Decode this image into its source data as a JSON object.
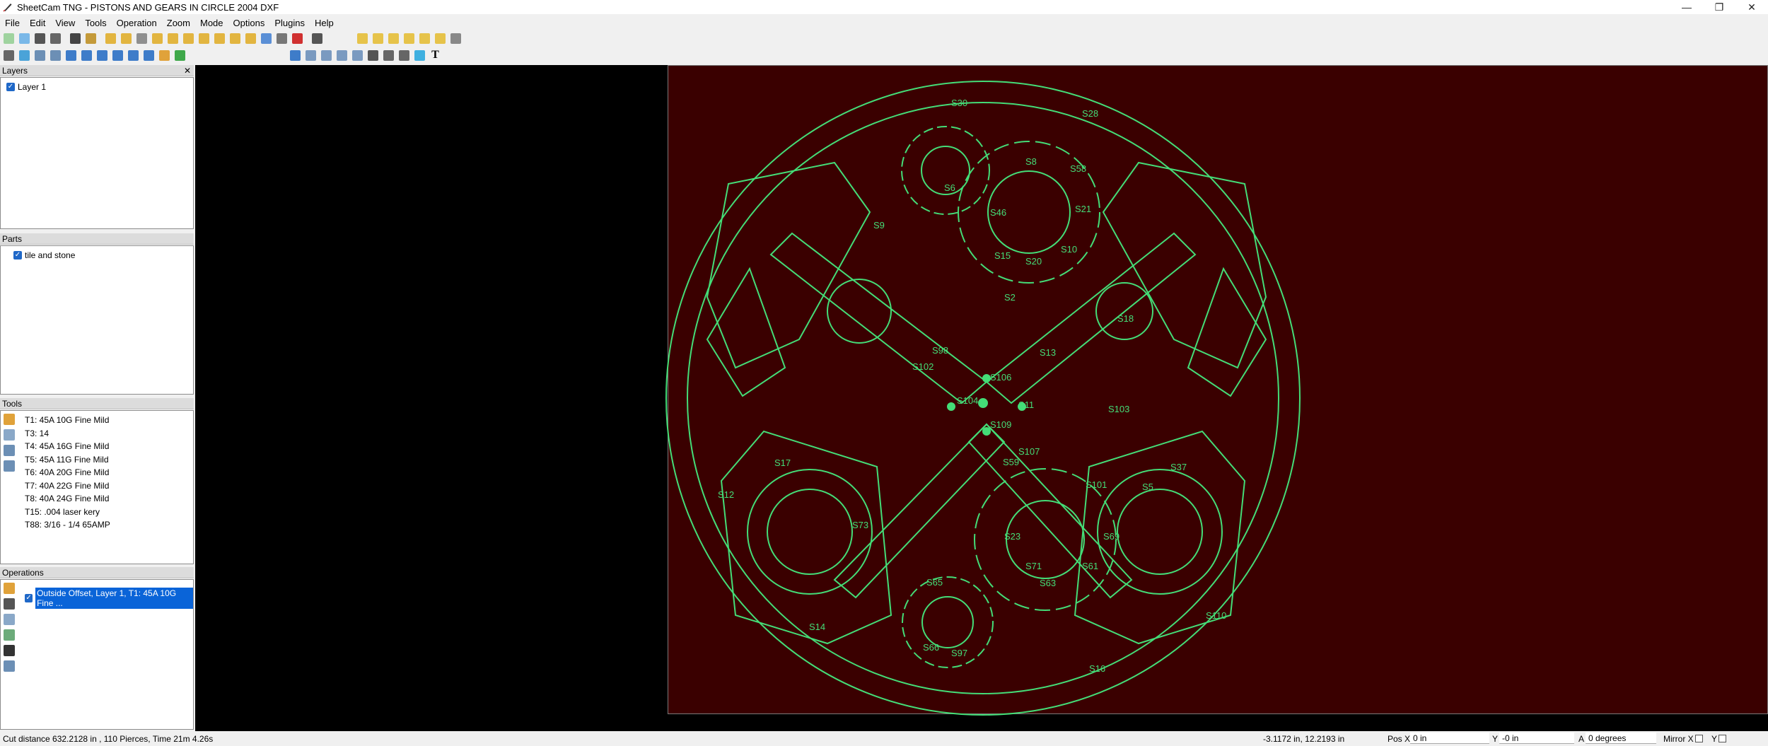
{
  "window": {
    "title": "SheetCam TNG - PISTONS AND GEARS IN CIRCLE 2004 DXF",
    "minimize": "—",
    "maximize": "❐",
    "close": "✕"
  },
  "menu": [
    "File",
    "Edit",
    "View",
    "Tools",
    "Operation",
    "Zoom",
    "Mode",
    "Options",
    "Plugins",
    "Help"
  ],
  "panels": {
    "layers": {
      "title": "Layers",
      "items": [
        "Layer 1"
      ]
    },
    "parts": {
      "title": "Parts",
      "items": [
        "tile and stone"
      ]
    },
    "tools": {
      "title": "Tools",
      "items": [
        "T1: 45A 10G Fine Mild",
        "T3: 14",
        "T4: 45A 16G Fine Mild",
        "T5: 45A 11G Fine Mild",
        "T6: 40A 20G Fine Mild",
        "T7: 40A 22G Fine Mild",
        "T8: 40A 24G Fine Mild",
        "T15: .004 laser kery",
        "T88: 3/16 - 1/4 65AMP"
      ]
    },
    "operations": {
      "title": "Operations",
      "items": [
        "Outside Offset, Layer 1, T1: 45A 10G Fine ..."
      ]
    }
  },
  "status": {
    "summary": "Cut distance 632.2128 in , 110 Pierces, Time 21m 4.26s",
    "cursor": "-3.1172 in, 12.2193 in",
    "posx_label": "Pos X",
    "posx_value": "0 in",
    "y_label": "Y",
    "y_value": "-0 in",
    "a_label": "A",
    "a_value": "0 degrees",
    "mirror_label": "Mirror X",
    "mirror_y_label": "Y"
  },
  "labels": [
    "S28",
    "S102",
    "S104",
    "S109",
    "S107",
    "S17",
    "S12",
    "S73",
    "S37",
    "S5",
    "S110",
    "S16",
    "S103",
    "S13",
    "S18",
    "S2",
    "S106",
    "S11",
    "S71",
    "S69",
    "S20",
    "S15",
    "S14",
    "S8",
    "S97",
    "S46",
    "S58",
    "S59",
    "S61",
    "S30",
    "S101",
    "S98",
    "S63",
    "S21",
    "S23",
    "S6",
    "S65",
    "S66",
    "S9",
    "S10"
  ],
  "colors": {
    "sheet": "#3a0000",
    "geometry": "#44dd77",
    "canvas": "#000000",
    "selection": "#0a64d8"
  }
}
